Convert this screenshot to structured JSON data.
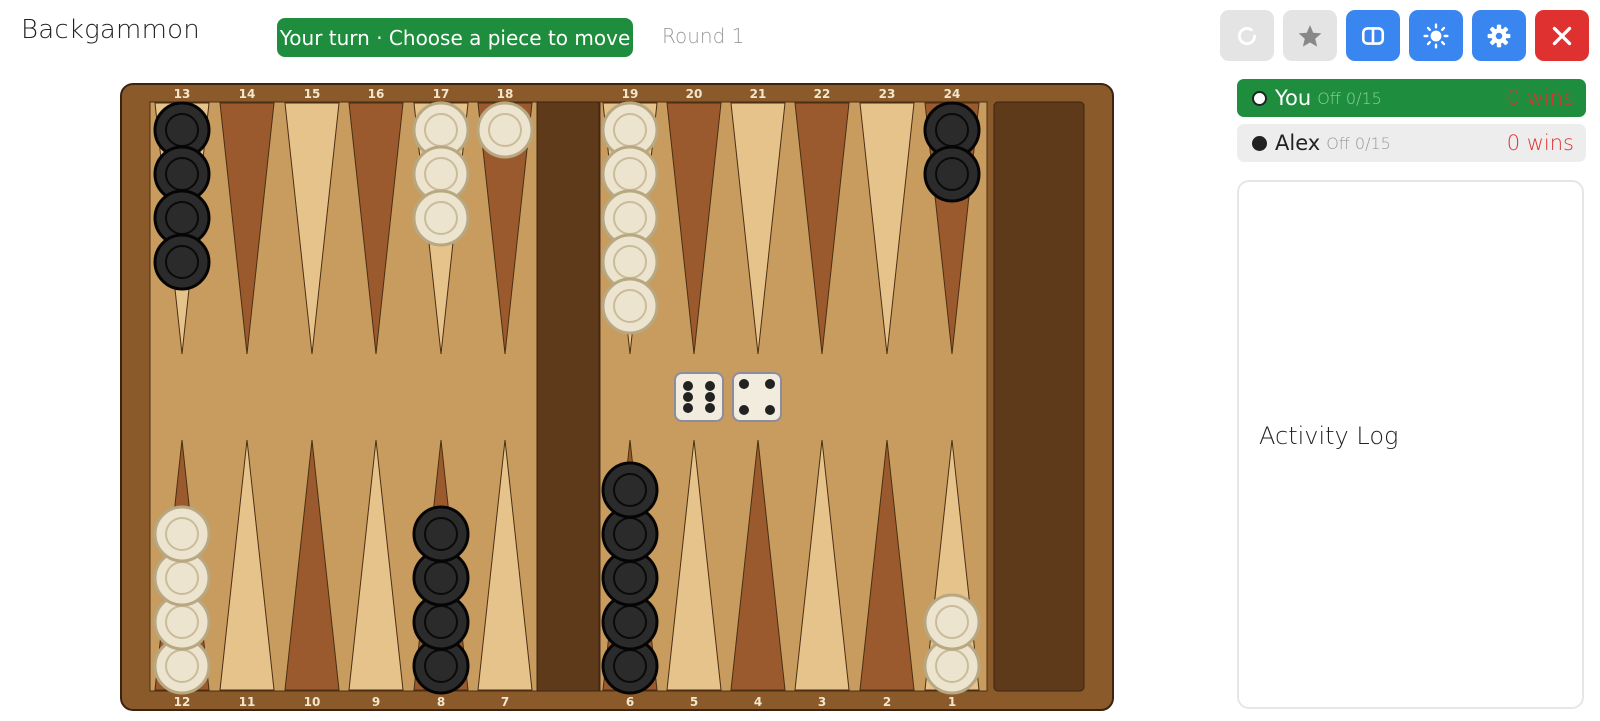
{
  "app": {
    "title": "Backgammon"
  },
  "status": {
    "text": "Your turn · Choose a piece to move"
  },
  "round": {
    "label": "Round 1"
  },
  "toolbar": [
    {
      "name": "undo-button",
      "icon": "undo-icon",
      "style": "gray"
    },
    {
      "name": "favorite-button",
      "icon": "star-icon",
      "style": "gray"
    },
    {
      "name": "board-view-button",
      "icon": "board-icon",
      "style": "blue"
    },
    {
      "name": "theme-button",
      "icon": "sun-icon",
      "style": "blue"
    },
    {
      "name": "settings-button",
      "icon": "gear-icon",
      "style": "blue"
    },
    {
      "name": "close-button",
      "icon": "close-icon",
      "style": "red"
    }
  ],
  "players": [
    {
      "name": "You",
      "off": "Off 0/15",
      "wins": "0 wins",
      "color": "white",
      "active": true
    },
    {
      "name": "Alex",
      "off": "Off 0/15",
      "wins": "0 wins",
      "color": "black",
      "active": false
    }
  ],
  "activity_log": {
    "title": "Activity Log"
  },
  "dice": [
    6,
    4
  ],
  "colors": {
    "status_green": "#1e8e3e",
    "accent_blue": "#3a86f0",
    "close_red": "#e03131",
    "board_frame": "#8a5a2b",
    "board_felt": "#c89b5e",
    "bar": "#5e3a1b",
    "point_dark": "#9b5a2d",
    "point_light": "#e6c38a"
  },
  "board": {
    "top_labels": [
      "13",
      "14",
      "15",
      "16",
      "17",
      "18",
      "19",
      "20",
      "21",
      "22",
      "23",
      "24"
    ],
    "bottom_labels": [
      "12",
      "11",
      "10",
      "9",
      "8",
      "7",
      "6",
      "5",
      "4",
      "3",
      "2",
      "1"
    ],
    "points": [
      {
        "point": 13,
        "color": "black",
        "count": 4
      },
      {
        "point": 17,
        "color": "white",
        "count": 3
      },
      {
        "point": 18,
        "color": "white",
        "count": 1
      },
      {
        "point": 19,
        "color": "white",
        "count": 5
      },
      {
        "point": 24,
        "color": "black",
        "count": 2
      },
      {
        "point": 12,
        "color": "white",
        "count": 4
      },
      {
        "point": 8,
        "color": "black",
        "count": 4
      },
      {
        "point": 6,
        "color": "black",
        "count": 5
      },
      {
        "point": 1,
        "color": "white",
        "count": 2
      }
    ]
  }
}
